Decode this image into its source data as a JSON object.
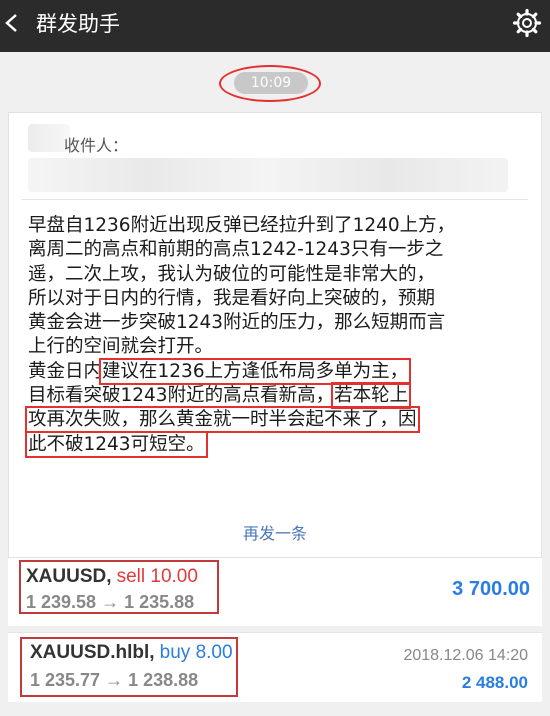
{
  "header": {
    "title": "群发助手"
  },
  "time_pill": "10:09",
  "message": {
    "recipients_label": "收件人：",
    "lines": [
      [
        "早盘自1236附近出现反弹已经拉升到了1240上方，"
      ],
      [
        "离周二的高点和前期的高点1242-1243只有一步之"
      ],
      [
        "遥，二次上攻，我认为破位的可能性是非常大的，"
      ],
      [
        "所以对于日内的行情，我是看好向上突破的，预期"
      ],
      [
        "黄金会进一步突破1243附近的压力，那么短期而言"
      ],
      [
        "上行的空间就会打开。"
      ],
      [
        "黄金日内",
        "建议在1236上方逢低布局多单为主，"
      ],
      [
        "目标看突破1243附近的高点看新高，",
        "若本轮上"
      ],
      [
        "攻再次失败，那么黄金就一时半会起不来了，因"
      ],
      [
        "此不破1243可短空。"
      ]
    ],
    "resend": "再发一条"
  },
  "trades": [
    {
      "symbol": "XAUUSD,",
      "side": "sell 10.00",
      "open": "1 239.58",
      "arrow": "→",
      "close": "1 235.88",
      "datetime": "",
      "profit": "3 700.00"
    },
    {
      "symbol": "XAUUSD.hlbl,",
      "side": "buy 8.00",
      "open": "1 235.77",
      "arrow": "→",
      "close": "1 238.88",
      "datetime": "2018.12.06 14:20",
      "profit": "2 488.00"
    }
  ]
}
